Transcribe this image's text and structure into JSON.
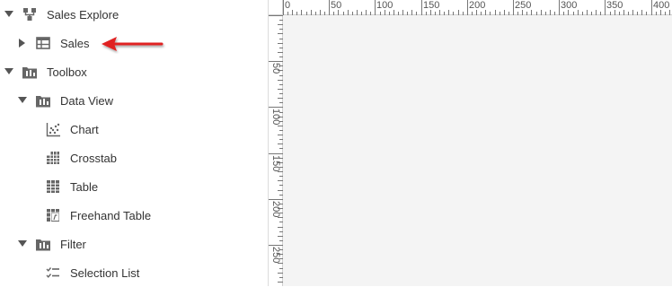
{
  "tree": {
    "items": [
      {
        "key": "sales-explore",
        "label": "Sales Explore",
        "icon": "source-icon",
        "expanded": true,
        "has_toggle": true,
        "depth": 0
      },
      {
        "key": "sales",
        "label": "Sales",
        "icon": "table-grid-icon",
        "expanded": false,
        "has_toggle": true,
        "depth": 1
      },
      {
        "key": "toolbox",
        "label": "Toolbox",
        "icon": "folder-chart-icon",
        "expanded": true,
        "has_toggle": true,
        "depth": 0
      },
      {
        "key": "data-view",
        "label": "Data View",
        "icon": "folder-chart-icon",
        "expanded": true,
        "has_toggle": true,
        "depth": 1
      },
      {
        "key": "chart",
        "label": "Chart",
        "icon": "scatter-chart-icon",
        "has_toggle": false,
        "depth": 2
      },
      {
        "key": "crosstab",
        "label": "Crosstab",
        "icon": "crosstab-icon",
        "has_toggle": false,
        "depth": 2
      },
      {
        "key": "table",
        "label": "Table",
        "icon": "table-icon",
        "has_toggle": false,
        "depth": 2
      },
      {
        "key": "freehand-table",
        "label": "Freehand Table",
        "icon": "freehand-table-icon",
        "has_toggle": false,
        "depth": 2
      },
      {
        "key": "filter",
        "label": "Filter",
        "icon": "folder-chart-icon",
        "expanded": true,
        "has_toggle": true,
        "depth": 1
      },
      {
        "key": "selection-list",
        "label": "Selection List",
        "icon": "selection-list-icon",
        "has_toggle": false,
        "depth": 2
      }
    ]
  },
  "annotation": {
    "icon": "red-arrow-icon",
    "color": "#e02020"
  },
  "ruler": {
    "horizontal_labels": [
      "0",
      "50",
      "100",
      "150",
      "200",
      "250",
      "300",
      "350",
      "400"
    ],
    "vertical_labels": [
      "50",
      "100",
      "150",
      "200",
      "250"
    ]
  },
  "colors": {
    "icon": "#666666",
    "canvas": "#f4f4f4",
    "ruler": "#ffffff"
  }
}
